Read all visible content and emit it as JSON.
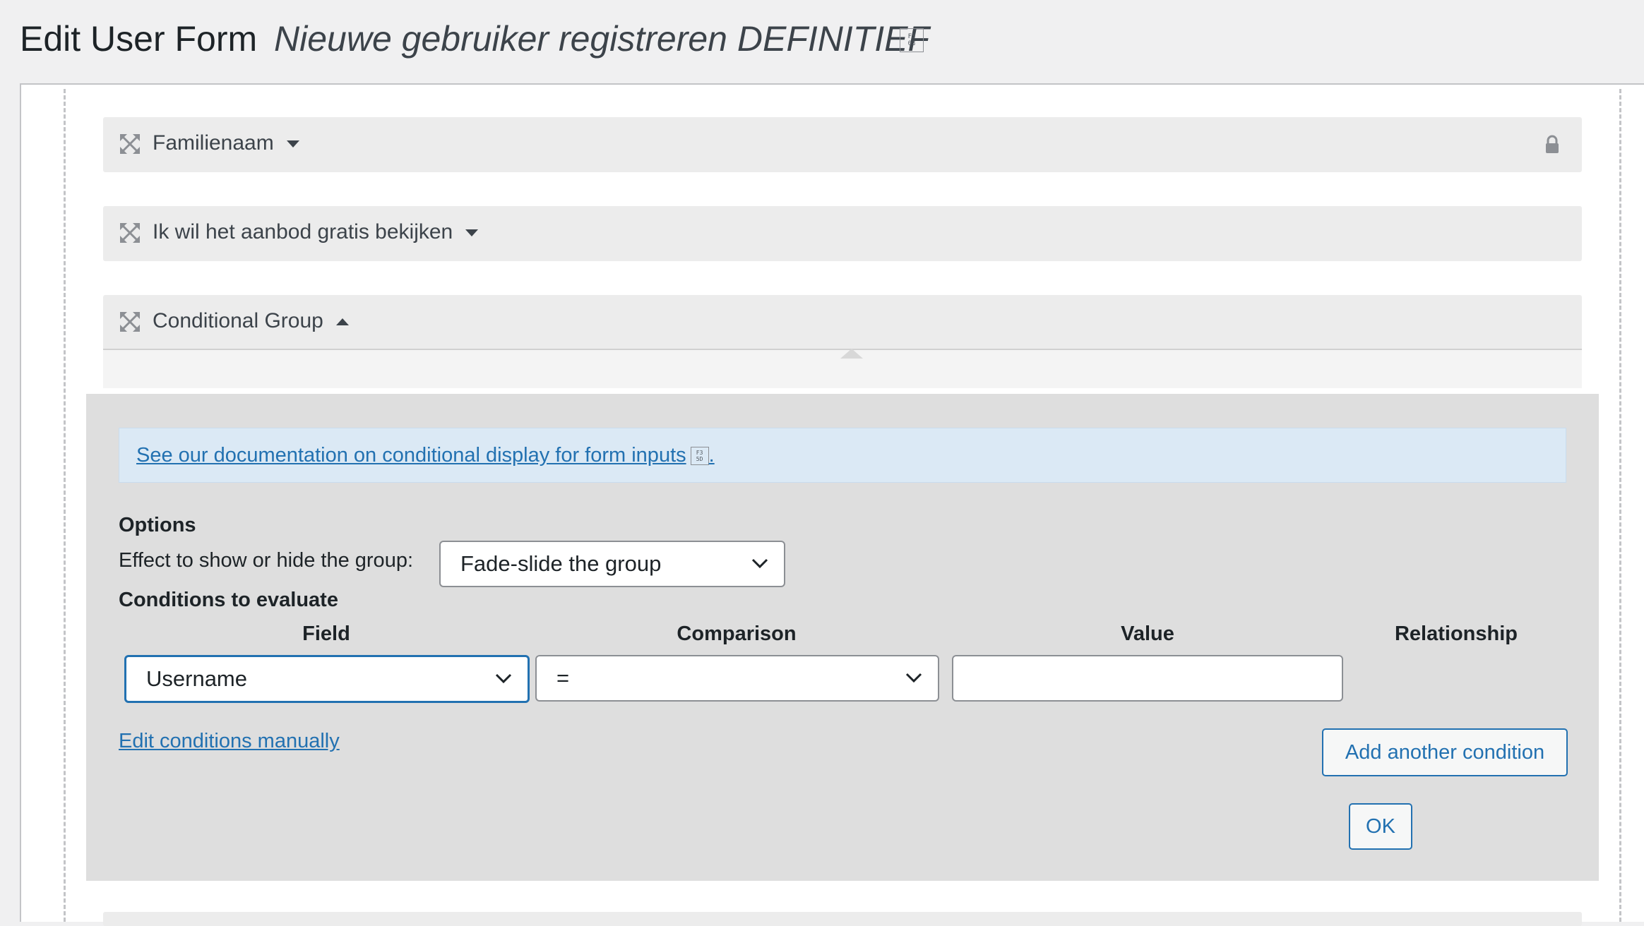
{
  "header": {
    "title": "Edit User Form",
    "form_name": "Nieuwe gebruiker registreren DEFINITIEF",
    "glyph": "F3\n03"
  },
  "fields": [
    {
      "label": "Familienaam",
      "state": "collapsed",
      "locked": true
    },
    {
      "label": "Ik wil het aanbod gratis bekijken",
      "state": "collapsed",
      "locked": false
    },
    {
      "label": "Conditional Group",
      "state": "expanded",
      "locked": false
    }
  ],
  "panel": {
    "doc_link_text": "See our documentation on conditional display for form inputs",
    "doc_link_glyph": "F3\n5D",
    "doc_link_suffix": ".",
    "options_title": "Options",
    "effect_label": "Effect to show or hide the group:",
    "effect_value": "Fade-slide the group",
    "conditions_title": "Conditions to evaluate",
    "columns": {
      "field": "Field",
      "comparison": "Comparison",
      "value": "Value",
      "relationship": "Relationship"
    },
    "condition": {
      "field": "Username",
      "comparison": "=",
      "value": ""
    },
    "edit_manual_label": "Edit conditions manually",
    "add_condition_label": "Add another condition",
    "ok_label": "OK"
  },
  "colors": {
    "link": "#2271b1",
    "panel_bg": "#dedede",
    "notice_bg": "#dbe9f5",
    "field_bar_bg": "#ececec"
  },
  "icons": {
    "drag": "move-arrows-icon",
    "lock": "lock-icon",
    "dropdown": "chevron-down-icon"
  }
}
